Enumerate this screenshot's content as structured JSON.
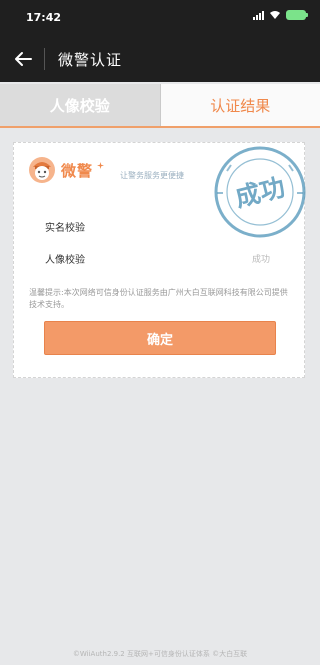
{
  "status_bar": {
    "time": "17:42"
  },
  "nav": {
    "title": "微警认证"
  },
  "tabs": [
    {
      "label": "人像校验",
      "active": false
    },
    {
      "label": "认证结果",
      "active": true
    }
  ],
  "card": {
    "logo_text": "微警",
    "tagline": "让警务服务更便捷",
    "stamp_text": "成功",
    "rows": [
      {
        "label": "实名校验",
        "value": ""
      },
      {
        "label": "人像校验",
        "value": "成功"
      }
    ],
    "tip": "温馨提示:本次网络可信身份认证服务由广州大白互联网科技有限公司提供技术支持。",
    "confirm_label": "确定"
  },
  "footer": "©WiiAuth2.9.2 互联网+可信身份认证体系 ©大白互联",
  "colors": {
    "accent": "#f0894c",
    "button": "#f39a68",
    "stamp": "#4f94b8",
    "bar": "#1f1f1f"
  }
}
